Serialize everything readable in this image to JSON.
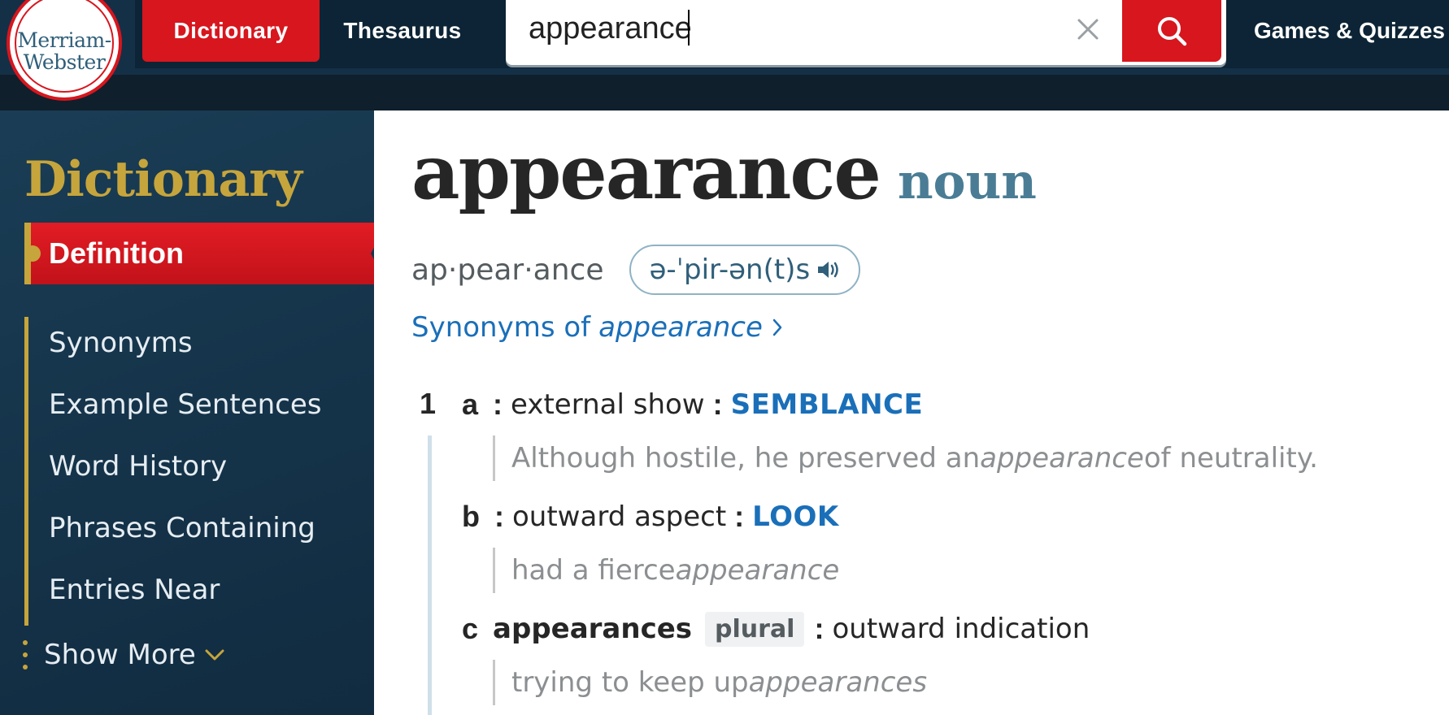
{
  "header": {
    "logo": {
      "line1": "Merriam-",
      "line2": "Webster"
    },
    "tabs": {
      "dictionary": "Dictionary",
      "thesaurus": "Thesaurus"
    },
    "search": {
      "value": "appearance"
    },
    "games_link": "Games & Quizzes",
    "icons": {
      "clear": "close-icon",
      "search": "search-icon"
    }
  },
  "colors": {
    "brand_red": "#d7161e",
    "header_navy": "#143047",
    "sidebar_navy": "#143248",
    "gold": "#c6a53c",
    "link_blue": "#1a6fb9",
    "pos_teal": "#4a7d95"
  },
  "sidebar": {
    "title": "Dictionary",
    "active_item": "Definition",
    "items": [
      "Synonyms",
      "Example Sentences",
      "Word History",
      "Phrases Containing",
      "Entries Near"
    ],
    "show_more": "Show More"
  },
  "entry": {
    "headword": "appearance",
    "part_of_speech": "noun",
    "syllables": "ap·pear·ance",
    "pronunciation": "ə-ˈpir-ən(t)s",
    "synonyms_link": {
      "prefix": "Synonyms of",
      "word": "appearance"
    },
    "definition": {
      "number": "1",
      "senses": [
        {
          "letter": "a",
          "colon": ":",
          "text": "external show",
          "xref_colon": ":",
          "xref": "SEMBLANCE",
          "example": {
            "before": "Although hostile, he preserved an ",
            "italic": "appearance",
            "after": " of neutrality."
          }
        },
        {
          "letter": "b",
          "colon": ":",
          "text": "outward aspect",
          "xref_colon": ":",
          "xref": "LOOK",
          "example": {
            "before": "had a fierce ",
            "italic": "appearance",
            "after": ""
          }
        },
        {
          "letter": "c",
          "form": "appearances",
          "label": "plural",
          "colon": ":",
          "text": "outward indication",
          "example": {
            "before": "trying to keep up ",
            "italic": "appearances",
            "after": ""
          }
        }
      ]
    }
  }
}
